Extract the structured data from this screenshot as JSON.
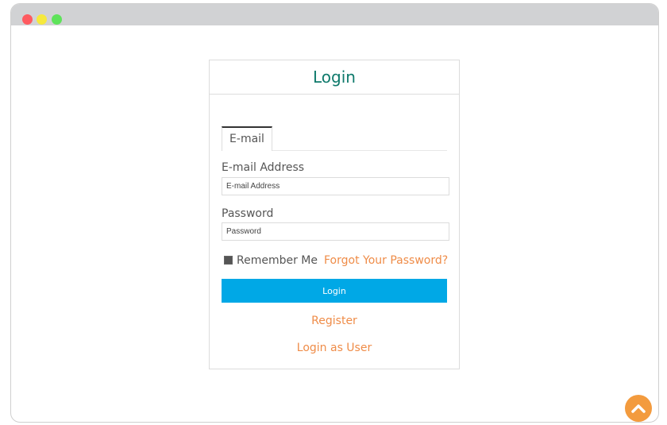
{
  "window": {
    "controls": [
      "close-dot",
      "minimize-dot",
      "maximize-dot"
    ]
  },
  "card": {
    "title": "Login",
    "tab": "E-mail",
    "email": {
      "label": "E-mail Address",
      "placeholder": "E-mail Address",
      "value": ""
    },
    "password": {
      "label": "Password",
      "placeholder": "Password",
      "value": ""
    },
    "remember": {
      "label": "Remember Me",
      "checked": true
    },
    "forgot_link": "Forgot Your Password?",
    "login_button": "Login",
    "register_link": "Register",
    "login_as_user_link": "Login as User"
  },
  "scroll_top": {
    "icon": "chevron-up-icon"
  },
  "colors": {
    "accent_teal": "#0f7a6c",
    "link_orange": "#ef8c48",
    "button_blue": "#00a8e6",
    "scroll_orange": "#f39b3e"
  }
}
